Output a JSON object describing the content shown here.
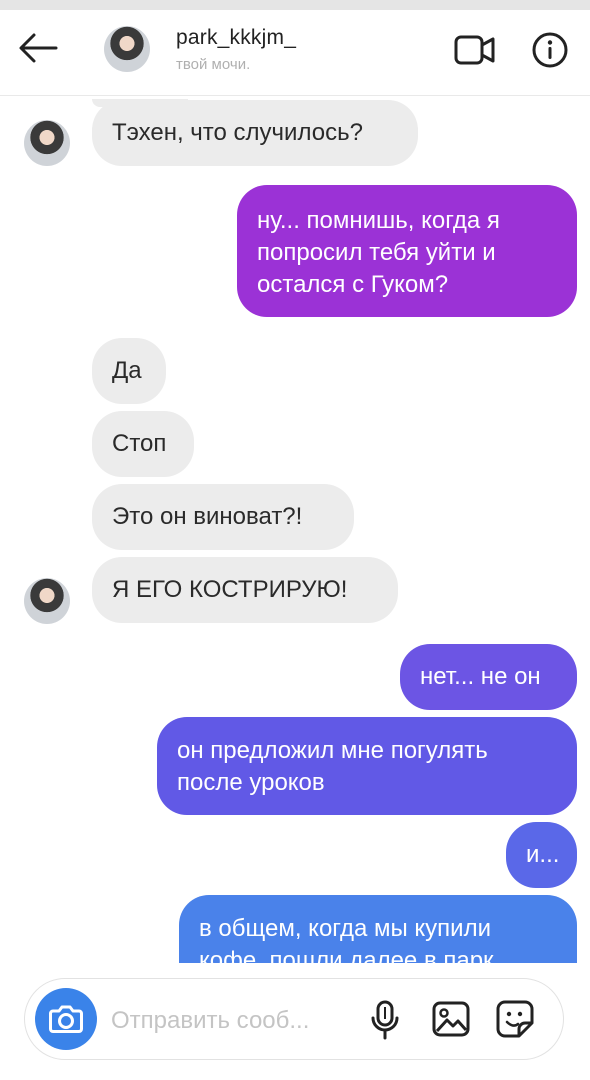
{
  "header": {
    "username": "park_kkkjm_",
    "subtitle": "твой мочи."
  },
  "icons": {
    "back": "arrow-left-icon",
    "video": "video-camera-icon",
    "info": "info-icon",
    "camera": "camera-icon",
    "mic": "microphone-icon",
    "gallery": "image-icon",
    "sticker": "sticker-icon"
  },
  "messages": [
    {
      "from": "them",
      "text": "Тэхен, что случилось?"
    },
    {
      "from": "me",
      "text": "ну... помнишь, когда я попросил тебя уйти и остался с Гуком?"
    },
    {
      "from": "them",
      "text": "Да"
    },
    {
      "from": "them",
      "text": "Стоп"
    },
    {
      "from": "them",
      "text": "Это он виноват?!"
    },
    {
      "from": "them",
      "text": "Я ЕГО КОСТРИРУЮ!"
    },
    {
      "from": "me",
      "text": "нет... не он"
    },
    {
      "from": "me",
      "text": "он предложил мне погулять после уроков"
    },
    {
      "from": "me",
      "text": "и..."
    },
    {
      "from": "me",
      "text": "в общем, когда мы купили кофе, пошли далее в парк"
    }
  ],
  "composer": {
    "placeholder": "Отправить сооб..."
  },
  "colors": {
    "incoming_bubble": "#ececec",
    "outgoing_purple": "#9b32d6",
    "outgoing_indigo": "#6a57e6",
    "outgoing_blue": "#4a82ea",
    "camera_button": "#3a83e9"
  }
}
